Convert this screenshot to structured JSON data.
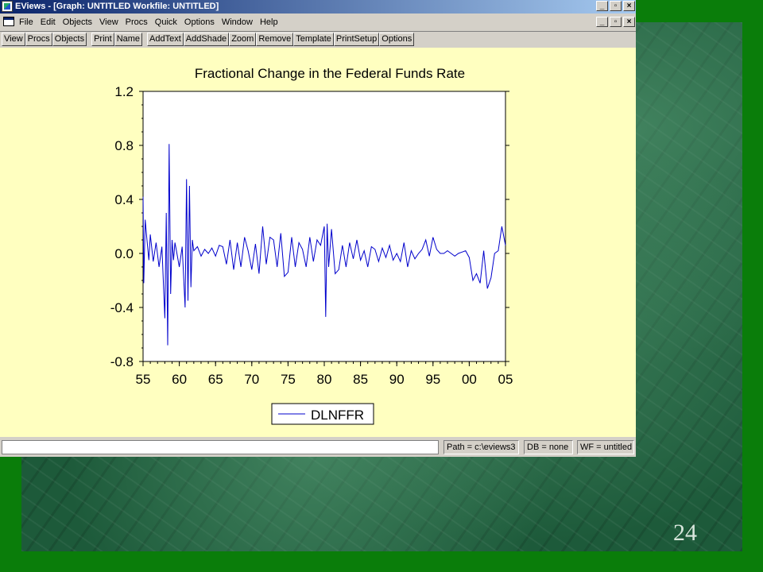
{
  "window": {
    "title": "EViews - [Graph: UNTITLED   Workfile: UNTITLED]"
  },
  "menu": [
    "File",
    "Edit",
    "Objects",
    "View",
    "Procs",
    "Quick",
    "Options",
    "Window",
    "Help"
  ],
  "toolbar": {
    "group1": [
      "View",
      "Procs",
      "Objects"
    ],
    "group2": [
      "Print",
      "Name"
    ],
    "group3": [
      "AddText",
      "AddShade",
      "Zoom",
      "Remove",
      "Template",
      "PrintSetup",
      "Options"
    ]
  },
  "window_buttons": {
    "minimize": "_",
    "restore": "▫",
    "close": "×"
  },
  "status": {
    "path": "Path = c:\\eviews3",
    "db": "DB = none",
    "wf": "WF = untitled"
  },
  "slide": {
    "number": "24"
  },
  "colors": {
    "plot_bg": "#ffffc0",
    "line": "#0000cc",
    "titlebar": "#0a246a"
  },
  "chart_data": {
    "type": "line",
    "title": "Fractional Change in the Federal Funds Rate",
    "x_tick_labels": [
      "55",
      "60",
      "65",
      "70",
      "75",
      "80",
      "85",
      "90",
      "95",
      "00",
      "05"
    ],
    "xlim": [
      1955,
      2005
    ],
    "ylim": [
      -0.8,
      1.2
    ],
    "y_ticks": [
      -0.8,
      -0.4,
      0.0,
      0.4,
      0.8,
      1.2
    ],
    "y_tick_labels": [
      "-0.8",
      "-0.4",
      "0.0",
      "0.4",
      "0.8",
      "1.2"
    ],
    "legend": "bottom-center",
    "grid": false,
    "series": [
      {
        "name": "DLNFFR",
        "x": [
          1955.0,
          1955.1,
          1955.3,
          1955.5,
          1955.8,
          1956.0,
          1956.4,
          1956.8,
          1957.2,
          1957.6,
          1958.0,
          1958.2,
          1958.4,
          1958.6,
          1958.8,
          1959.0,
          1959.2,
          1959.4,
          1959.6,
          1960.0,
          1960.4,
          1960.8,
          1961.0,
          1961.2,
          1961.4,
          1961.6,
          1961.8,
          1962.0,
          1962.5,
          1963.0,
          1963.5,
          1964.0,
          1964.5,
          1965.0,
          1965.5,
          1966.0,
          1966.5,
          1967.0,
          1967.5,
          1968.0,
          1968.5,
          1969.0,
          1969.5,
          1970.0,
          1970.5,
          1971.0,
          1971.5,
          1972.0,
          1972.5,
          1973.0,
          1973.5,
          1974.0,
          1974.5,
          1975.0,
          1975.5,
          1976.0,
          1976.5,
          1977.0,
          1977.5,
          1978.0,
          1978.5,
          1979.0,
          1979.5,
          1980.0,
          1980.2,
          1980.4,
          1980.6,
          1981.0,
          1981.5,
          1982.0,
          1982.5,
          1983.0,
          1983.5,
          1984.0,
          1984.5,
          1985.0,
          1985.5,
          1986.0,
          1986.5,
          1987.0,
          1987.5,
          1988.0,
          1988.5,
          1989.0,
          1989.5,
          1990.0,
          1990.5,
          1991.0,
          1991.5,
          1992.0,
          1992.5,
          1993.0,
          1993.5,
          1994.0,
          1994.5,
          1995.0,
          1995.5,
          1996.0,
          1996.5,
          1997.0,
          1997.5,
          1998.0,
          1998.5,
          1999.0,
          1999.5,
          2000.0,
          2000.5,
          2001.0,
          2001.5,
          2002.0,
          2002.5,
          2003.0,
          2003.5,
          2004.0,
          2004.5,
          2005.0
        ],
        "values": [
          0.42,
          -0.22,
          0.25,
          0.12,
          -0.05,
          0.14,
          -0.06,
          0.08,
          -0.1,
          0.05,
          -0.48,
          0.3,
          -0.68,
          0.81,
          -0.3,
          0.1,
          -0.05,
          0.08,
          0.02,
          -0.1,
          0.05,
          -0.4,
          0.55,
          -0.35,
          0.5,
          -0.25,
          0.1,
          0.02,
          0.05,
          -0.02,
          0.03,
          0.0,
          0.04,
          -0.02,
          0.06,
          0.05,
          -0.08,
          0.1,
          -0.12,
          0.08,
          -0.1,
          0.12,
          0.02,
          -0.12,
          0.07,
          -0.15,
          0.2,
          -0.08,
          0.12,
          0.1,
          -0.1,
          0.15,
          -0.17,
          -0.14,
          0.12,
          -0.1,
          0.08,
          0.03,
          -0.1,
          0.12,
          -0.06,
          0.1,
          0.06,
          0.2,
          -0.47,
          0.22,
          -0.1,
          0.18,
          -0.15,
          -0.12,
          0.06,
          -0.1,
          0.08,
          -0.04,
          0.1,
          -0.05,
          0.02,
          -0.1,
          0.05,
          0.03,
          -0.06,
          0.04,
          -0.03,
          0.06,
          -0.05,
          0.0,
          -0.06,
          0.08,
          -0.1,
          0.02,
          -0.04,
          0.0,
          0.03,
          0.1,
          -0.02,
          0.12,
          0.03,
          0.0,
          0.0,
          0.02,
          0.0,
          -0.02,
          0.0,
          0.01,
          0.02,
          -0.03,
          -0.2,
          -0.15,
          -0.22,
          0.02,
          -0.26,
          -0.18,
          0.0,
          0.02,
          0.2,
          0.06
        ]
      }
    ],
    "legend_entries": [
      "DLNFFR"
    ]
  }
}
